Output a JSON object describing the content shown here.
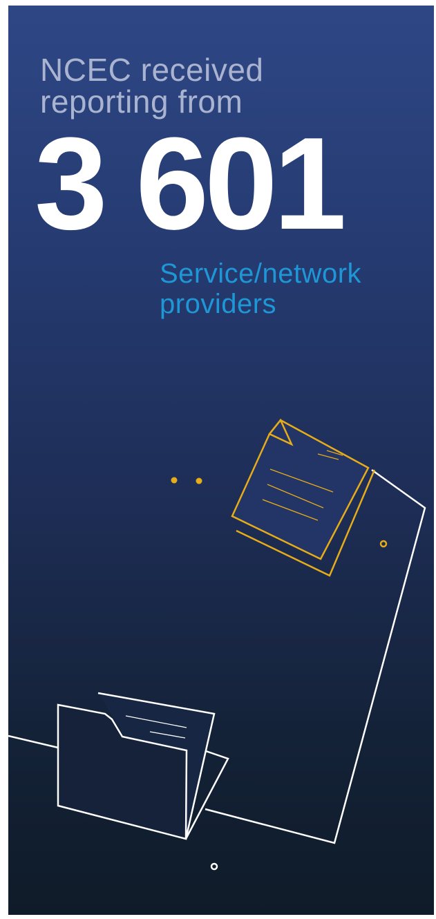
{
  "headline": {
    "line1": "NCEC received",
    "line2": "reporting from"
  },
  "statistic": {
    "value": "3 601"
  },
  "caption": {
    "line1": "Service/network",
    "line2": "providers"
  },
  "colors": {
    "background_top": "#2e4785",
    "background_bottom": "#0f1b28",
    "headline": "#aab4d0",
    "statistic": "#ffffff",
    "caption": "#1f96d6",
    "accent": "#e6ac1a",
    "line_art": "#ffffff"
  },
  "illustration": {
    "icons": [
      "document-stack-icon",
      "folder-icon",
      "sheet-outline",
      "dot-icon",
      "ring-icon"
    ]
  }
}
